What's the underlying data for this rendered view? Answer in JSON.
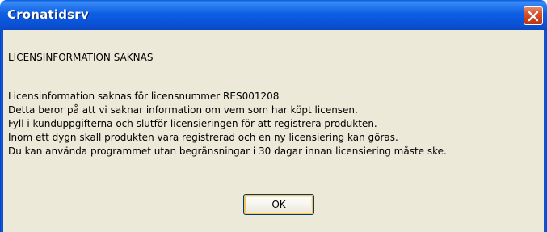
{
  "window": {
    "title": "Cronatidsrv",
    "close_icon": "close-x-icon"
  },
  "message": {
    "heading": "LICENSINFORMATION SAKNAS",
    "lines": [
      "Licensinformation saknas för licensnummer RES001208",
      "Detta beror på att vi saknar information om vem som har köpt licensen.",
      "Fyll i kunduppgifterna och slutför licensieringen för att registrera produkten.",
      "Inom ett dygn skall produkten vara registrerad och en ny licensiering kan göras.",
      "Du kan använda programmet utan begränsningar i 30 dagar innan licensiering måste ske."
    ]
  },
  "buttons": {
    "ok_label": "OK"
  },
  "colors": {
    "titlebar": "#0a55db",
    "client_background": "#ece9d8",
    "close_button": "#d9532d",
    "ok_focus": "#f5c55f"
  }
}
